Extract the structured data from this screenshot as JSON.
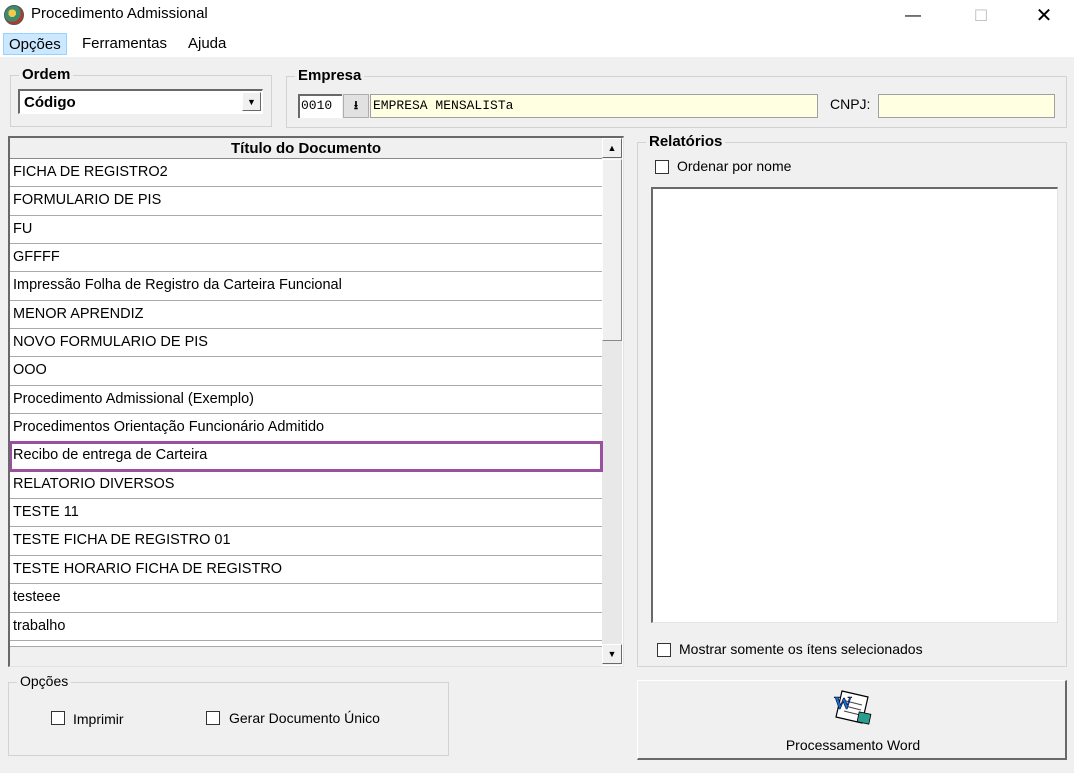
{
  "window": {
    "title": "Procedimento Admissional",
    "icon": "app-globe-icon",
    "minimize": "—",
    "maximize": "☐",
    "close": "✕"
  },
  "menu": [
    "Opções",
    "Ferramentas",
    "Ajuda"
  ],
  "ordem": {
    "label": "Ordem",
    "selected": "Código"
  },
  "empresa": {
    "label": "Empresa",
    "code": "0010",
    "name": "EMPRESA MENSALISTa",
    "cnpj_label": "CNPJ:",
    "cnpj_value": ""
  },
  "documents": {
    "header": "Título do Documento",
    "rows": [
      "FICHA DE REGISTRO2",
      "FORMULARIO DE PIS",
      "FU",
      "GFFFF",
      "Impressão Folha de Registro da Carteira Funcional",
      "MENOR APRENDIZ",
      "NOVO FORMULARIO DE PIS",
      "OOO",
      "Procedimento Admissional (Exemplo)",
      "Procedimentos Orientação Funcionário Admitido",
      "Recibo de entrega de Carteira",
      "RELATORIO DIVERSOS",
      "TESTE 11",
      "TESTE FICHA DE REGISTRO 01",
      "TESTE HORARIO FICHA DE REGISTRO",
      "testeee",
      "trabalho"
    ],
    "selected_index": 10,
    "highlight_color": "#9b4f9f"
  },
  "relatorios": {
    "label": "Relatórios",
    "ordenar_label": "Ordenar por nome",
    "mostrar_label": "Mostrar somente os ítens selecionados"
  },
  "opcoes": {
    "label": "Opções",
    "imprimir_label": "Imprimir",
    "gerar_label": "Gerar Documento Único"
  },
  "word_button": {
    "label": "Processamento Word",
    "icon": "word-document-icon"
  }
}
